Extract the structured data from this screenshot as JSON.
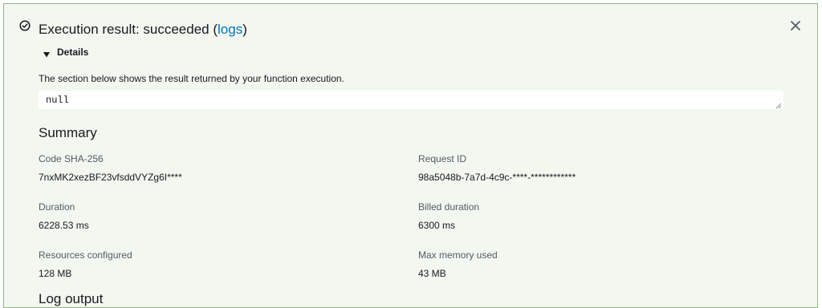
{
  "header": {
    "title": "Execution result: succeeded",
    "paren_open": " (",
    "logs_link": "logs",
    "paren_close": ")",
    "status_icon": "check-circle-icon",
    "close_icon": "close-icon"
  },
  "details": {
    "label": "Details",
    "description": "The section below shows the result returned by your function execution.",
    "result": "null"
  },
  "summary": {
    "title": "Summary",
    "code_sha_label": "Code SHA-256",
    "code_sha_value": "7nxMK2xezBF23vfsddVYZg6I****",
    "request_id_label": "Request ID",
    "request_id_value": "98a5048b-7a7d-4c9c-****-************",
    "duration_label": "Duration",
    "duration_value": "6228.53 ms",
    "billed_label": "Billed duration",
    "billed_value": "6300 ms",
    "resources_label": "Resources configured",
    "resources_value": "128 MB",
    "max_memory_label": "Max memory used",
    "max_memory_value": "43 MB",
    "next_heading_partial": "Log output"
  },
  "colors": {
    "success_bg": "#f2f8f0",
    "success_border": "#8fb57f",
    "link": "#0073bb",
    "text": "#16191f",
    "label": "#545b64"
  }
}
